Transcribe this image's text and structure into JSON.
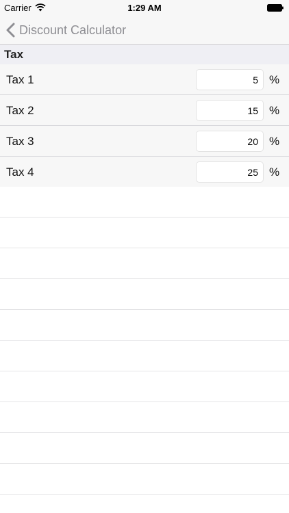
{
  "status_bar": {
    "carrier": "Carrier",
    "time": "1:29 AM",
    "icons": [
      "wifi-icon",
      "battery-icon"
    ]
  },
  "nav": {
    "back_label": "Discount Calculator",
    "back_icon": "chevron-left-icon",
    "tint_color": "#8e8e93"
  },
  "section": {
    "title": "Tax"
  },
  "taxes": [
    {
      "label": "Tax 1",
      "value": "5",
      "suffix": "%"
    },
    {
      "label": "Tax 2",
      "value": "15",
      "suffix": "%"
    },
    {
      "label": "Tax 3",
      "value": "20",
      "suffix": "%"
    },
    {
      "label": "Tax 4",
      "value": "25",
      "suffix": "%"
    }
  ]
}
